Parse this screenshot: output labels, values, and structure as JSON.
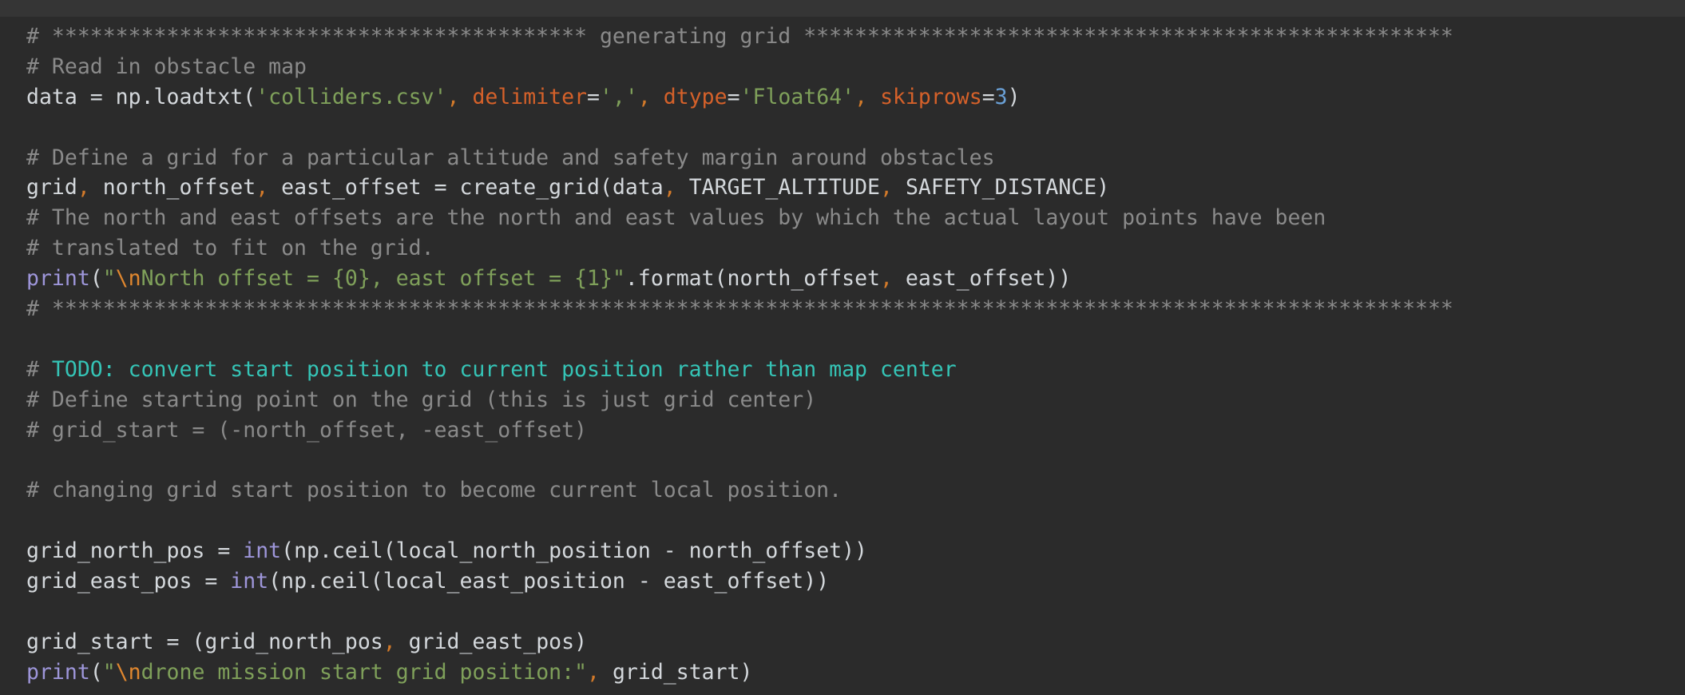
{
  "editor": {
    "lines": [
      [
        {
          "k": "comment",
          "t": "# ****************************************** generating grid ***************************************************"
        }
      ],
      [
        {
          "k": "comment",
          "t": "# Read in obstacle map"
        }
      ],
      [
        {
          "k": "plain",
          "t": "data = np.loadtxt("
        },
        {
          "k": "string",
          "t": "'colliders.csv'"
        },
        {
          "k": "punct",
          "t": ", "
        },
        {
          "k": "keyword",
          "t": "delimiter"
        },
        {
          "k": "plain",
          "t": "="
        },
        {
          "k": "string",
          "t": "','"
        },
        {
          "k": "punct",
          "t": ", "
        },
        {
          "k": "keyword",
          "t": "dtype"
        },
        {
          "k": "plain",
          "t": "="
        },
        {
          "k": "string",
          "t": "'Float64'"
        },
        {
          "k": "punct",
          "t": ", "
        },
        {
          "k": "keyword",
          "t": "skiprows"
        },
        {
          "k": "plain",
          "t": "="
        },
        {
          "k": "number",
          "t": "3"
        },
        {
          "k": "plain",
          "t": ")"
        }
      ],
      [],
      [
        {
          "k": "comment",
          "t": "# Define a grid for a particular altitude and safety margin around obstacles"
        }
      ],
      [
        {
          "k": "plain",
          "t": "grid"
        },
        {
          "k": "punct",
          "t": ", "
        },
        {
          "k": "plain",
          "t": "north_offset"
        },
        {
          "k": "punct",
          "t": ", "
        },
        {
          "k": "plain",
          "t": "east_offset = create_grid(data"
        },
        {
          "k": "punct",
          "t": ", "
        },
        {
          "k": "plain",
          "t": "TARGET_ALTITUDE"
        },
        {
          "k": "punct",
          "t": ", "
        },
        {
          "k": "plain",
          "t": "SAFETY_DISTANCE)"
        }
      ],
      [
        {
          "k": "comment",
          "t": "# The north and east offsets are the north and east values by which the actual layout points have been"
        }
      ],
      [
        {
          "k": "comment",
          "t": "# translated to fit on the grid."
        }
      ],
      [
        {
          "k": "builtin",
          "t": "print"
        },
        {
          "k": "plain",
          "t": "("
        },
        {
          "k": "string",
          "t": "\""
        },
        {
          "k": "escape",
          "t": "\\n"
        },
        {
          "k": "string",
          "t": "North offset = {0}, east offset = {1}\""
        },
        {
          "k": "plain",
          "t": ".format(north_offset"
        },
        {
          "k": "punct",
          "t": ", "
        },
        {
          "k": "plain",
          "t": "east_offset))"
        }
      ],
      [
        {
          "k": "comment",
          "t": "# **************************************************************************************************************"
        }
      ],
      [],
      [
        {
          "k": "comment",
          "t": "# "
        },
        {
          "k": "todo",
          "t": "TODO: convert start position to current position rather than map center"
        }
      ],
      [
        {
          "k": "comment",
          "t": "# Define starting point on the grid (this is just grid center)"
        }
      ],
      [
        {
          "k": "comment",
          "t": "# grid_start = (-north_offset, -east_offset)"
        }
      ],
      [],
      [
        {
          "k": "comment",
          "t": "# changing grid start position to become current local position."
        }
      ],
      [],
      [
        {
          "k": "plain",
          "t": "grid_north_pos = "
        },
        {
          "k": "builtin",
          "t": "int"
        },
        {
          "k": "plain",
          "t": "(np.ceil(local_north_position - north_offset))"
        }
      ],
      [
        {
          "k": "plain",
          "t": "grid_east_pos = "
        },
        {
          "k": "builtin",
          "t": "int"
        },
        {
          "k": "plain",
          "t": "(np.ceil(local_east_position - east_offset))"
        }
      ],
      [],
      [
        {
          "k": "plain",
          "t": "grid_start = (grid_north_pos"
        },
        {
          "k": "punct",
          "t": ", "
        },
        {
          "k": "plain",
          "t": "grid_east_pos)"
        }
      ],
      [
        {
          "k": "builtin",
          "t": "print"
        },
        {
          "k": "plain",
          "t": "("
        },
        {
          "k": "string",
          "t": "\""
        },
        {
          "k": "escape",
          "t": "\\n"
        },
        {
          "k": "string",
          "t": "drone mission start grid position:\""
        },
        {
          "k": "punct",
          "t": ", "
        },
        {
          "k": "plain",
          "t": "grid_start)"
        }
      ]
    ]
  }
}
